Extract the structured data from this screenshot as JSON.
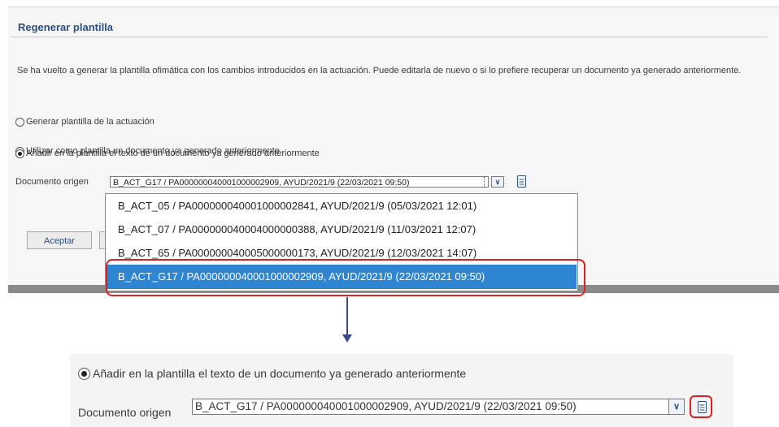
{
  "panel": {
    "title": "Regenerar plantilla",
    "description": "Se ha vuelto a generar la plantilla ofimática con los cambios introducidos en la actuación. Puede editarla de nuevo o si lo prefiere recuperar un documento ya generado anteriormente.",
    "options": [
      {
        "label": "Generar plantilla de la actuación",
        "checked": false
      },
      {
        "label": "Utilizar como plantilla un documento ya generado anteriormente",
        "checked": false
      },
      {
        "label": "Añadir en la plantilla el texto de un documento ya generado anteriormente",
        "checked": true
      }
    ],
    "doc_label": "Documento origen",
    "doc_selected": "B_ACT_G17 / PA00000004000100000290 9, AYUD/2021/9 (22/03/2021 09:50)",
    "dropdown_items": [
      "B_ACT_05 / PA000000040001000002841, AYUD/2021/9 (05/03/2021 12:01)",
      "B_ACT_07 / PA000000040004000000388, AYUD/2021/9 (11/03/2021 12:07)",
      "B_ACT_65 / PA000000040005000000173, AYUD/2021/9 (12/03/2021 14:07)",
      "B_ACT_G17 / PA000000040001000002909, AYUD/2021/9 (22/03/2021 09:50)"
    ],
    "accept_label": "Aceptar"
  },
  "zoom": {
    "option_label": "Añadir en la plantilla el texto de un documento ya generado anteriormente",
    "doc_label": "Documento origen",
    "doc_selected": "B_ACT_G17 / PA000000040001000002909, AYUD/2021/9 (22/03/2021 09:50)"
  },
  "icons": {
    "radio": "radio-icon",
    "dropdown_arrow": "chevron-down-icon",
    "document": "document-icon"
  },
  "colors": {
    "title": "#2b4f7e",
    "selection": "#2e86d3",
    "highlight": "#e02020",
    "arrow": "#3e4a8a"
  }
}
